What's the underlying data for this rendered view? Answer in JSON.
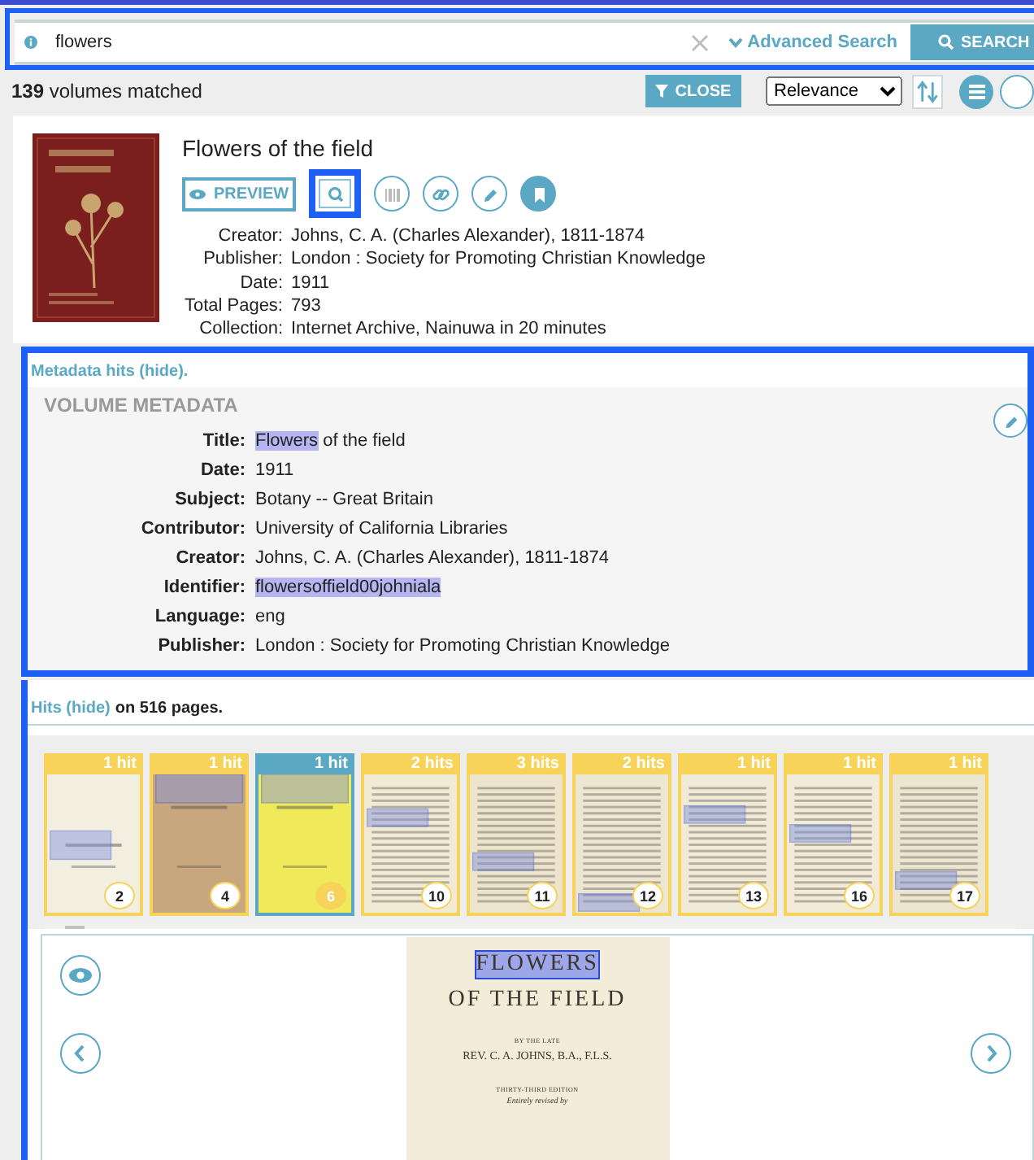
{
  "search": {
    "value": "flowers",
    "advanced_label": "Advanced Search",
    "button": "SEARCH",
    "highlighted": true
  },
  "results_bar": {
    "count": "139",
    "count_label": "volumes matched",
    "close_button": "CLOSE",
    "sort": "Relevance"
  },
  "volume": {
    "title": "Flowers of the field",
    "preview_button": "PREVIEW",
    "actions": [
      {
        "kind": "search",
        "highlighted": true
      },
      {
        "kind": "barcode",
        "highlighted": false
      },
      {
        "kind": "link",
        "highlighted": false
      },
      {
        "kind": "edit",
        "highlighted": false
      },
      {
        "kind": "bookmark",
        "highlighted": false
      }
    ],
    "fields": [
      {
        "label": "Creator:",
        "value": "Johns, C. A. (Charles Alexander), 1811-1874"
      },
      {
        "label": "Publisher:",
        "value": "London : Society for Promoting Christian Knowledge"
      },
      {
        "label": "Date:",
        "value": "1911"
      },
      {
        "label": "Total Pages:",
        "value": "793"
      },
      {
        "label": "Collection:",
        "value": "Internet Archive, Nainuwa in 20 minutes"
      }
    ]
  },
  "metadata": {
    "highlighted": true,
    "toggle_text": "Metadata hits (hide).",
    "heading": "VOLUME METADATA",
    "fields": [
      {
        "label": "Title:",
        "parts": [
          {
            "text": "Flowers",
            "match": true
          },
          {
            "text": " of the field",
            "match": false
          }
        ]
      },
      {
        "label": "Date:",
        "parts": [
          {
            "text": "1911",
            "match": false
          }
        ]
      },
      {
        "label": "Subject:",
        "parts": [
          {
            "text": "Botany -- Great Britain",
            "match": false
          }
        ]
      },
      {
        "label": "Contributor:",
        "parts": [
          {
            "text": "University of California Libraries",
            "match": false
          }
        ]
      },
      {
        "label": "Creator:",
        "parts": [
          {
            "text": "Johns, C. A. (Charles Alexander), 1811-1874",
            "match": false
          }
        ]
      },
      {
        "label": "Identifier:",
        "parts": [
          {
            "text": "flowersoffield00johniala",
            "match": true
          }
        ]
      },
      {
        "label": "Language:",
        "parts": [
          {
            "text": "eng",
            "match": false
          }
        ]
      },
      {
        "label": "Publisher:",
        "parts": [
          {
            "text": "London : Society for Promoting Christian Knowledge",
            "match": false
          }
        ]
      }
    ]
  },
  "hits": {
    "highlighted": true,
    "link": "Hits (hide)",
    "summary": "on 516 pages.",
    "thumbnails": [
      {
        "hits": "1 hit",
        "page": "2",
        "selected": false
      },
      {
        "hits": "1 hit",
        "page": "4",
        "selected": false
      },
      {
        "hits": "1 hit",
        "page": "6",
        "selected": true
      },
      {
        "hits": "2 hits",
        "page": "10",
        "selected": false
      },
      {
        "hits": "3 hits",
        "page": "11",
        "selected": false
      },
      {
        "hits": "2 hits",
        "page": "12",
        "selected": false
      },
      {
        "hits": "1 hit",
        "page": "13",
        "selected": false
      },
      {
        "hits": "1 hit",
        "page": "16",
        "selected": false
      },
      {
        "hits": "1 hit",
        "page": "17",
        "selected": false
      }
    ]
  },
  "preview": {
    "page_lines": [
      {
        "kind": "title",
        "text": "FLOWERS",
        "match": true
      },
      {
        "kind": "subtitle",
        "text": "OF THE FIELD",
        "match": false
      },
      {
        "kind": "small",
        "text": "BY THE LATE",
        "match": false
      },
      {
        "kind": "author",
        "text": "REV. C. A. JOHNS, B.A., F.L.S.",
        "match": false
      },
      {
        "kind": "small",
        "text": "THIRTY-THIRD EDITION",
        "match": false
      },
      {
        "kind": "italic",
        "text": "Entirely revised by",
        "match": false
      }
    ]
  }
}
